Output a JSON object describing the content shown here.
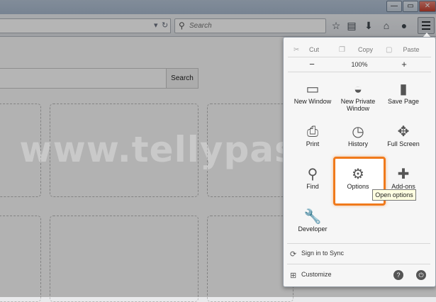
{
  "window": {
    "minimize": "—",
    "restore": "▭",
    "close": "✕"
  },
  "toolbar": {
    "search_placeholder": "Search",
    "icons": [
      "star-icon",
      "clipboard-icon",
      "download-icon",
      "home-icon",
      "chat-icon",
      "menu-icon"
    ]
  },
  "page": {
    "search_button": "Search"
  },
  "watermark": "www.tellypass.com",
  "menu": {
    "edit": {
      "cut": "Cut",
      "copy": "Copy",
      "paste": "Paste"
    },
    "zoom": {
      "out": "−",
      "level": "100%",
      "in": "+"
    },
    "items": [
      {
        "label": "New Window",
        "icon": "window-icon",
        "glyph": "▭"
      },
      {
        "label": "New Private Window",
        "icon": "mask-icon",
        "glyph": "◒"
      },
      {
        "label": "Save Page",
        "icon": "page-icon",
        "glyph": "▮"
      },
      {
        "label": "Print",
        "icon": "printer-icon",
        "glyph": "⎙"
      },
      {
        "label": "History",
        "icon": "clock-icon",
        "glyph": "◷"
      },
      {
        "label": "Full Screen",
        "icon": "fullscreen-icon",
        "glyph": "✥"
      },
      {
        "label": "Find",
        "icon": "magnifier-icon",
        "glyph": "⚲"
      },
      {
        "label": "Options",
        "icon": "gear-icon",
        "glyph": "⚙"
      },
      {
        "label": "Add-ons",
        "icon": "puzzle-icon",
        "glyph": "✚"
      },
      {
        "label": "Developer",
        "icon": "wrench-icon",
        "glyph": "🔧"
      }
    ],
    "tooltip": "Open options",
    "sign_in": "Sign in to Sync",
    "customize": "Customize",
    "help": "?",
    "quit": "⏻"
  },
  "colors": {
    "highlight": "#f07a1c",
    "tooltip_bg": "#ffffe1"
  }
}
